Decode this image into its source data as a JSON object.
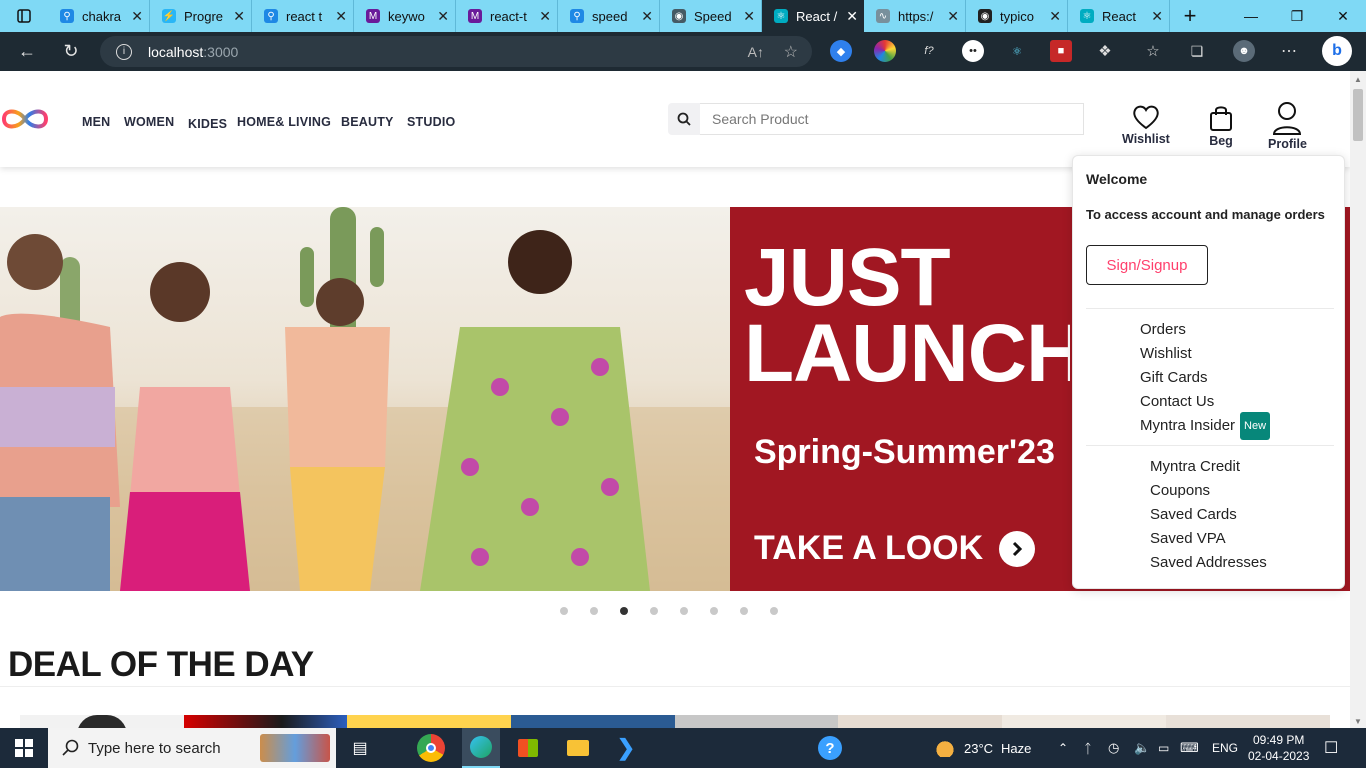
{
  "browser": {
    "tabs": [
      {
        "title": "chakra",
        "icon": "search-icon",
        "active": false
      },
      {
        "title": "Progre",
        "icon": "bolt-icon",
        "active": false
      },
      {
        "title": "react t",
        "icon": "search-icon",
        "active": false
      },
      {
        "title": "keywo",
        "icon": "m-icon",
        "active": false
      },
      {
        "title": "react-t",
        "icon": "m-icon",
        "active": false
      },
      {
        "title": "speed",
        "icon": "search-icon",
        "active": false
      },
      {
        "title": "Speed",
        "icon": "speed-icon",
        "active": false
      },
      {
        "title": "React /",
        "icon": "react-icon",
        "active": true
      },
      {
        "title": "https:/",
        "icon": "loading-icon",
        "active": false
      },
      {
        "title": "typico",
        "icon": "github-icon",
        "active": false
      },
      {
        "title": "React",
        "icon": "react-icon",
        "active": false
      }
    ],
    "url_host": "localhost",
    "url_port": ":3000"
  },
  "header": {
    "nav": [
      "MEN",
      "WOMEN",
      "KIDES",
      "HOME& LIVING",
      "BEAUTY",
      "STUDIO"
    ],
    "search_placeholder": "Search Product",
    "wishlist_label": "Wishlist",
    "bag_label": "Beg",
    "profile_label": "Profile"
  },
  "banner": {
    "line1": "JUST",
    "line2": "LAUNCH",
    "season": "Spring-Summer'23",
    "cta": "TAKE A LOOK",
    "dots": 8,
    "active_dot": 3
  },
  "section_title": "DEAL OF THE DAY",
  "dropdown": {
    "welcome": "Welcome",
    "subtitle": "To access account and manage orders",
    "signin": "Sign/Signup",
    "group1": [
      "Orders",
      "Wishlist",
      "Gift Cards",
      "Contact Us",
      "Myntra Insider"
    ],
    "new_badge": "New",
    "group2": [
      "Myntra Credit",
      "Coupons",
      "Saved Cards",
      "Saved VPA",
      "Saved Addresses"
    ]
  },
  "taskbar": {
    "search_placeholder": "Type here to search",
    "temperature": "23°C",
    "weather": "Haze",
    "language": "ENG",
    "time": "09:49 PM",
    "date": "02-04-2023"
  },
  "colors": {
    "accent_pink": "#ff3f6c",
    "banner_red": "#a11722",
    "tabstrip": "#7fd9f5",
    "badge_teal": "#07877a"
  }
}
